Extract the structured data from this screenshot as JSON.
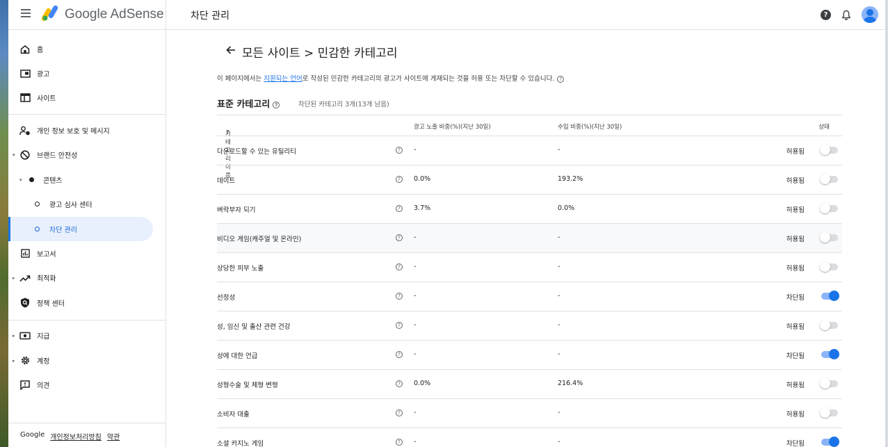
{
  "app": {
    "brand": "Google AdSense",
    "page_heading": "차단 관리"
  },
  "sidebar": {
    "items": [
      {
        "label": "홈"
      },
      {
        "label": "광고"
      },
      {
        "label": "사이트"
      },
      {
        "label": "개인 정보 보호 및 메시지"
      },
      {
        "label": "브랜드 안전성"
      },
      {
        "label": "콘텐츠"
      },
      {
        "label": "광고 심사 센터"
      },
      {
        "label": "차단 관리"
      },
      {
        "label": "보고서"
      },
      {
        "label": "최적화"
      },
      {
        "label": "정책 센터"
      },
      {
        "label": "지급"
      },
      {
        "label": "계정"
      },
      {
        "label": "의견"
      }
    ],
    "footer": {
      "google": "Google",
      "privacy": "개인정보처리방침",
      "terms": "약관"
    }
  },
  "main": {
    "title": "모든 사이트 > 민감한 카테고리",
    "desc_prefix": "이 페이지에서는 ",
    "desc_link": "지원되는 언어",
    "desc_suffix": "로 작성된 민감한 카테고리의 광고가 사이트에 게재되는 것을 허용 또는 차단할 수 있습니다.",
    "section_title": "표준 카테고리",
    "section_sub": "차단된 카테고리 3개(13개 남음)",
    "columns": {
      "name": "카테고리 이름",
      "impressions": "광고 노출 비중(%)(지난 30일)",
      "revenue": "수입 비중(%)(지난 30일)",
      "status": "상태"
    },
    "rows": [
      {
        "name": "다운로드할 수 있는 유틸리티",
        "impressions": "-",
        "revenue": "-",
        "status": "허용됨",
        "on": false
      },
      {
        "name": "데이트",
        "impressions": "0.0%",
        "revenue": "193.2%",
        "status": "허용됨",
        "on": false
      },
      {
        "name": "벼락부자 되기",
        "impressions": "3.7%",
        "revenue": "0.0%",
        "status": "허용됨",
        "on": false
      },
      {
        "name": "비디오 게임(캐주얼 및 온라인)",
        "impressions": "-",
        "revenue": "-",
        "status": "허용됨",
        "on": false
      },
      {
        "name": "상당한 피부 노출",
        "impressions": "-",
        "revenue": "-",
        "status": "허용됨",
        "on": false
      },
      {
        "name": "선정성",
        "impressions": "-",
        "revenue": "-",
        "status": "차단됨",
        "on": true
      },
      {
        "name": "성, 임신 및 출산 관련 건강",
        "impressions": "-",
        "revenue": "-",
        "status": "허용됨",
        "on": false
      },
      {
        "name": "성에 대한 언급",
        "impressions": "-",
        "revenue": "-",
        "status": "차단됨",
        "on": true
      },
      {
        "name": "성형수술 및 체형 변형",
        "impressions": "0.0%",
        "revenue": "216.4%",
        "status": "허용됨",
        "on": false
      },
      {
        "name": "소비자 대출",
        "impressions": "-",
        "revenue": "-",
        "status": "허용됨",
        "on": false
      },
      {
        "name": "소셜 카지노 게임",
        "impressions": "-",
        "revenue": "-",
        "status": "차단됨",
        "on": true
      }
    ]
  },
  "colors": {
    "accent": "#1a73e8",
    "active_bg": "#e8f0fe"
  }
}
